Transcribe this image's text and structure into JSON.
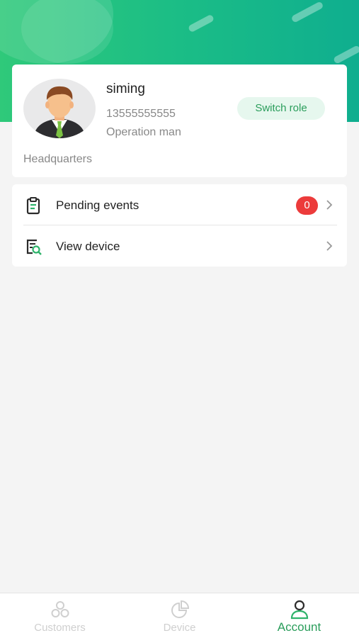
{
  "profile": {
    "username": "siming",
    "phone": "13555555555",
    "role": "Operation man",
    "switch_role_label": "Switch role",
    "organization": "Headquarters"
  },
  "menu": {
    "items": [
      {
        "label": "Pending events",
        "icon": "clipboard-icon",
        "badge": "0"
      },
      {
        "label": "View device",
        "icon": "device-search-icon"
      }
    ]
  },
  "tabbar": {
    "tabs": [
      {
        "label": "Customers",
        "icon": "customers-icon",
        "active": false
      },
      {
        "label": "Device",
        "icon": "device-chart-icon",
        "active": false
      },
      {
        "label": "Account",
        "icon": "account-icon",
        "active": true
      }
    ]
  },
  "colors": {
    "header_start": "#2fc97a",
    "header_end": "#0fae8f",
    "accent_green": "#2a9d5b",
    "badge_red": "#ec3b3b"
  }
}
